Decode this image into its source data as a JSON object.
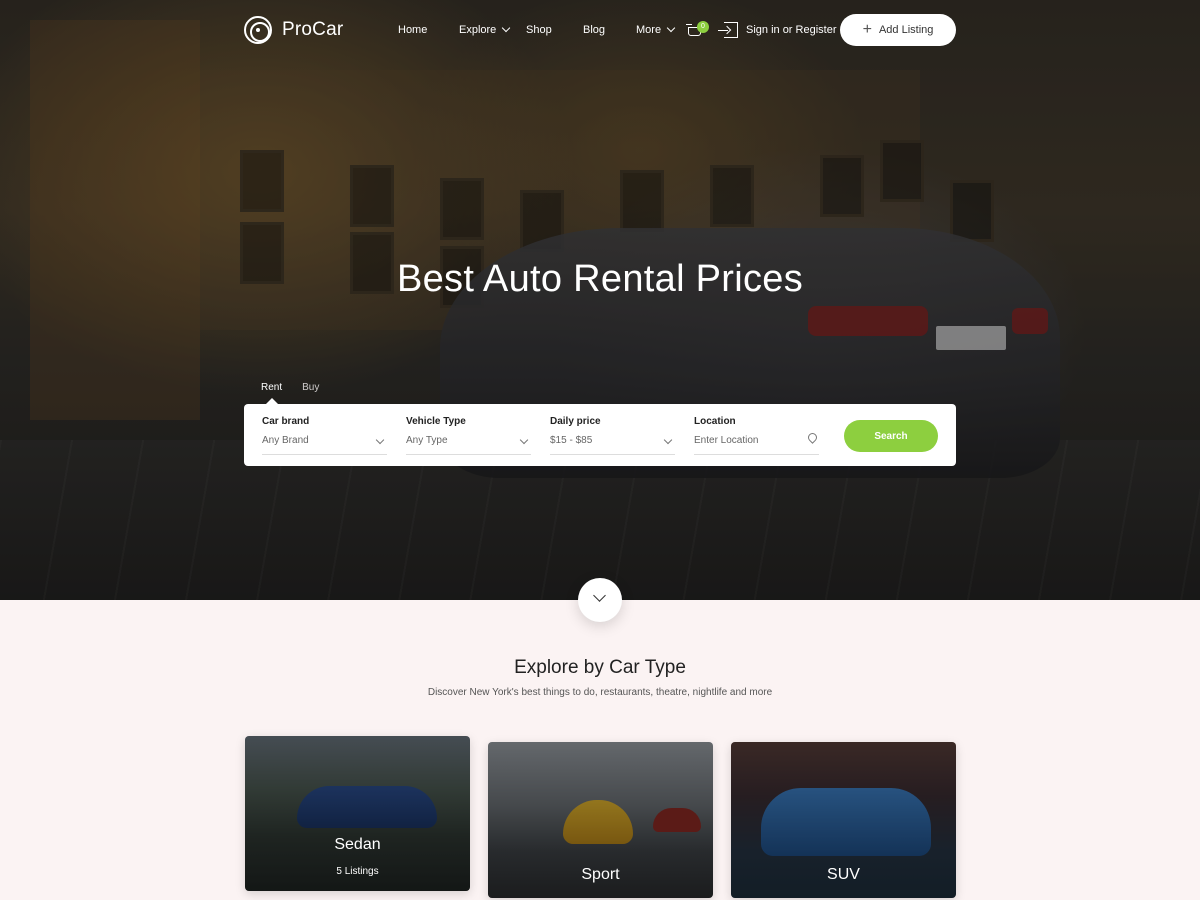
{
  "brand": {
    "name": "ProCar"
  },
  "nav": {
    "items": [
      {
        "label": "Home"
      },
      {
        "label": "Explore",
        "dropdown": true
      },
      {
        "label": "Shop"
      },
      {
        "label": "Blog"
      },
      {
        "label": "More",
        "dropdown": true
      }
    ],
    "cart_count": "0",
    "signin_label": "Sign in or Register",
    "add_listing_label": "Add Listing"
  },
  "hero": {
    "title": "Best Auto Rental Prices",
    "tabs": [
      {
        "label": "Rent",
        "active": true
      },
      {
        "label": "Buy",
        "active": false
      }
    ],
    "search": {
      "fields": [
        {
          "label": "Car brand",
          "value": "Any Brand",
          "icon": "chevron-down-icon"
        },
        {
          "label": "Vehicle Type",
          "value": "Any Type",
          "icon": "chevron-down-icon"
        },
        {
          "label": "Daily price",
          "value": "$15 - $85",
          "icon": "chevron-down-icon"
        },
        {
          "label": "Location",
          "placeholder": "Enter Location",
          "icon": "location-pin-icon"
        }
      ],
      "button_label": "Search"
    }
  },
  "section": {
    "title": "Explore by Car Type",
    "subtitle": "Discover New York's best things to do, restaurants, theatre, nightlife and more",
    "cards": [
      {
        "name": "Sedan",
        "count": "5 Listings"
      },
      {
        "name": "Sport"
      },
      {
        "name": "SUV"
      }
    ]
  },
  "colors": {
    "accent": "#8dcf3f",
    "section_bg": "#fbf3f3"
  }
}
